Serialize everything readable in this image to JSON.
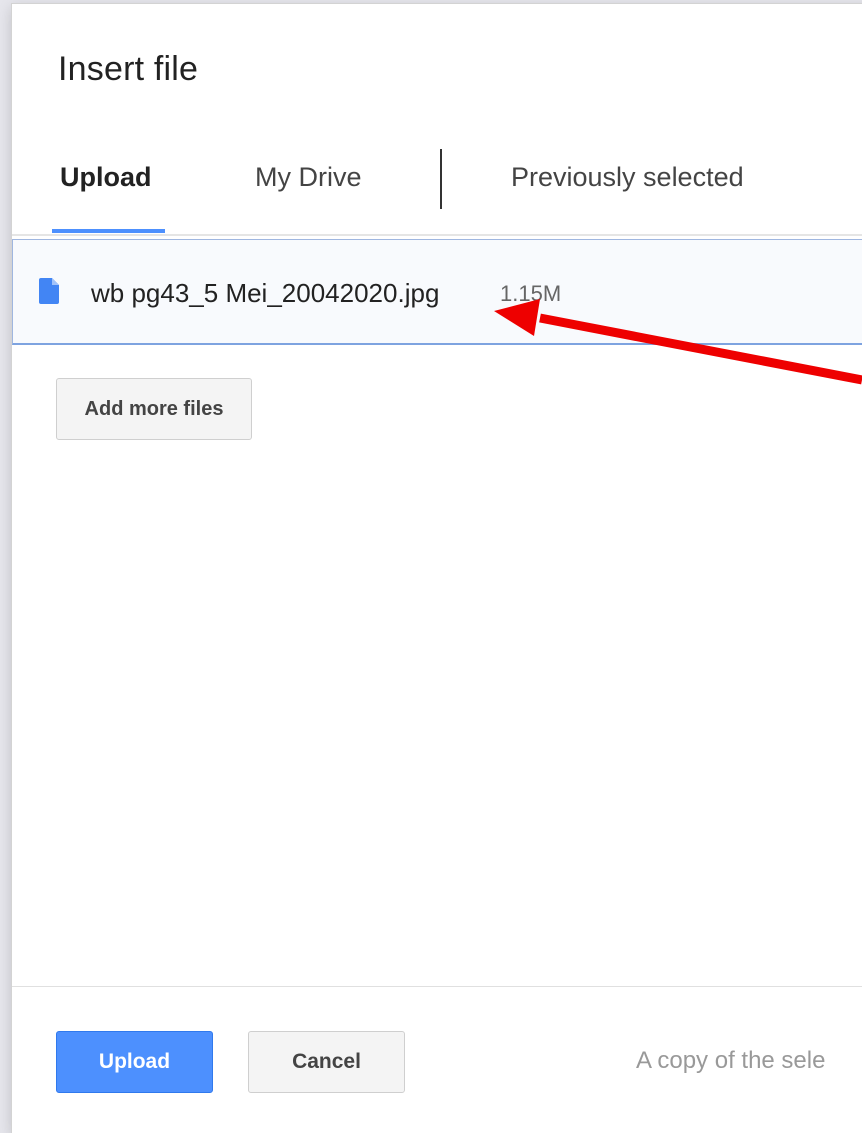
{
  "dialog": {
    "title": "Insert file"
  },
  "tabs": [
    {
      "label": "Upload",
      "active": true
    },
    {
      "label": "My Drive",
      "active": false
    },
    {
      "label": "Previously selected",
      "active": false
    }
  ],
  "file": {
    "name": "wb pg43_5 Mei_20042020.jpg",
    "size": "1.15M",
    "icon": "file-icon"
  },
  "buttons": {
    "add_more": "Add more files",
    "upload": "Upload",
    "cancel": "Cancel"
  },
  "footer": {
    "note": "A copy of the sele"
  },
  "colors": {
    "accent": "#4d90fe",
    "annotation_arrow": "#ee0000"
  }
}
